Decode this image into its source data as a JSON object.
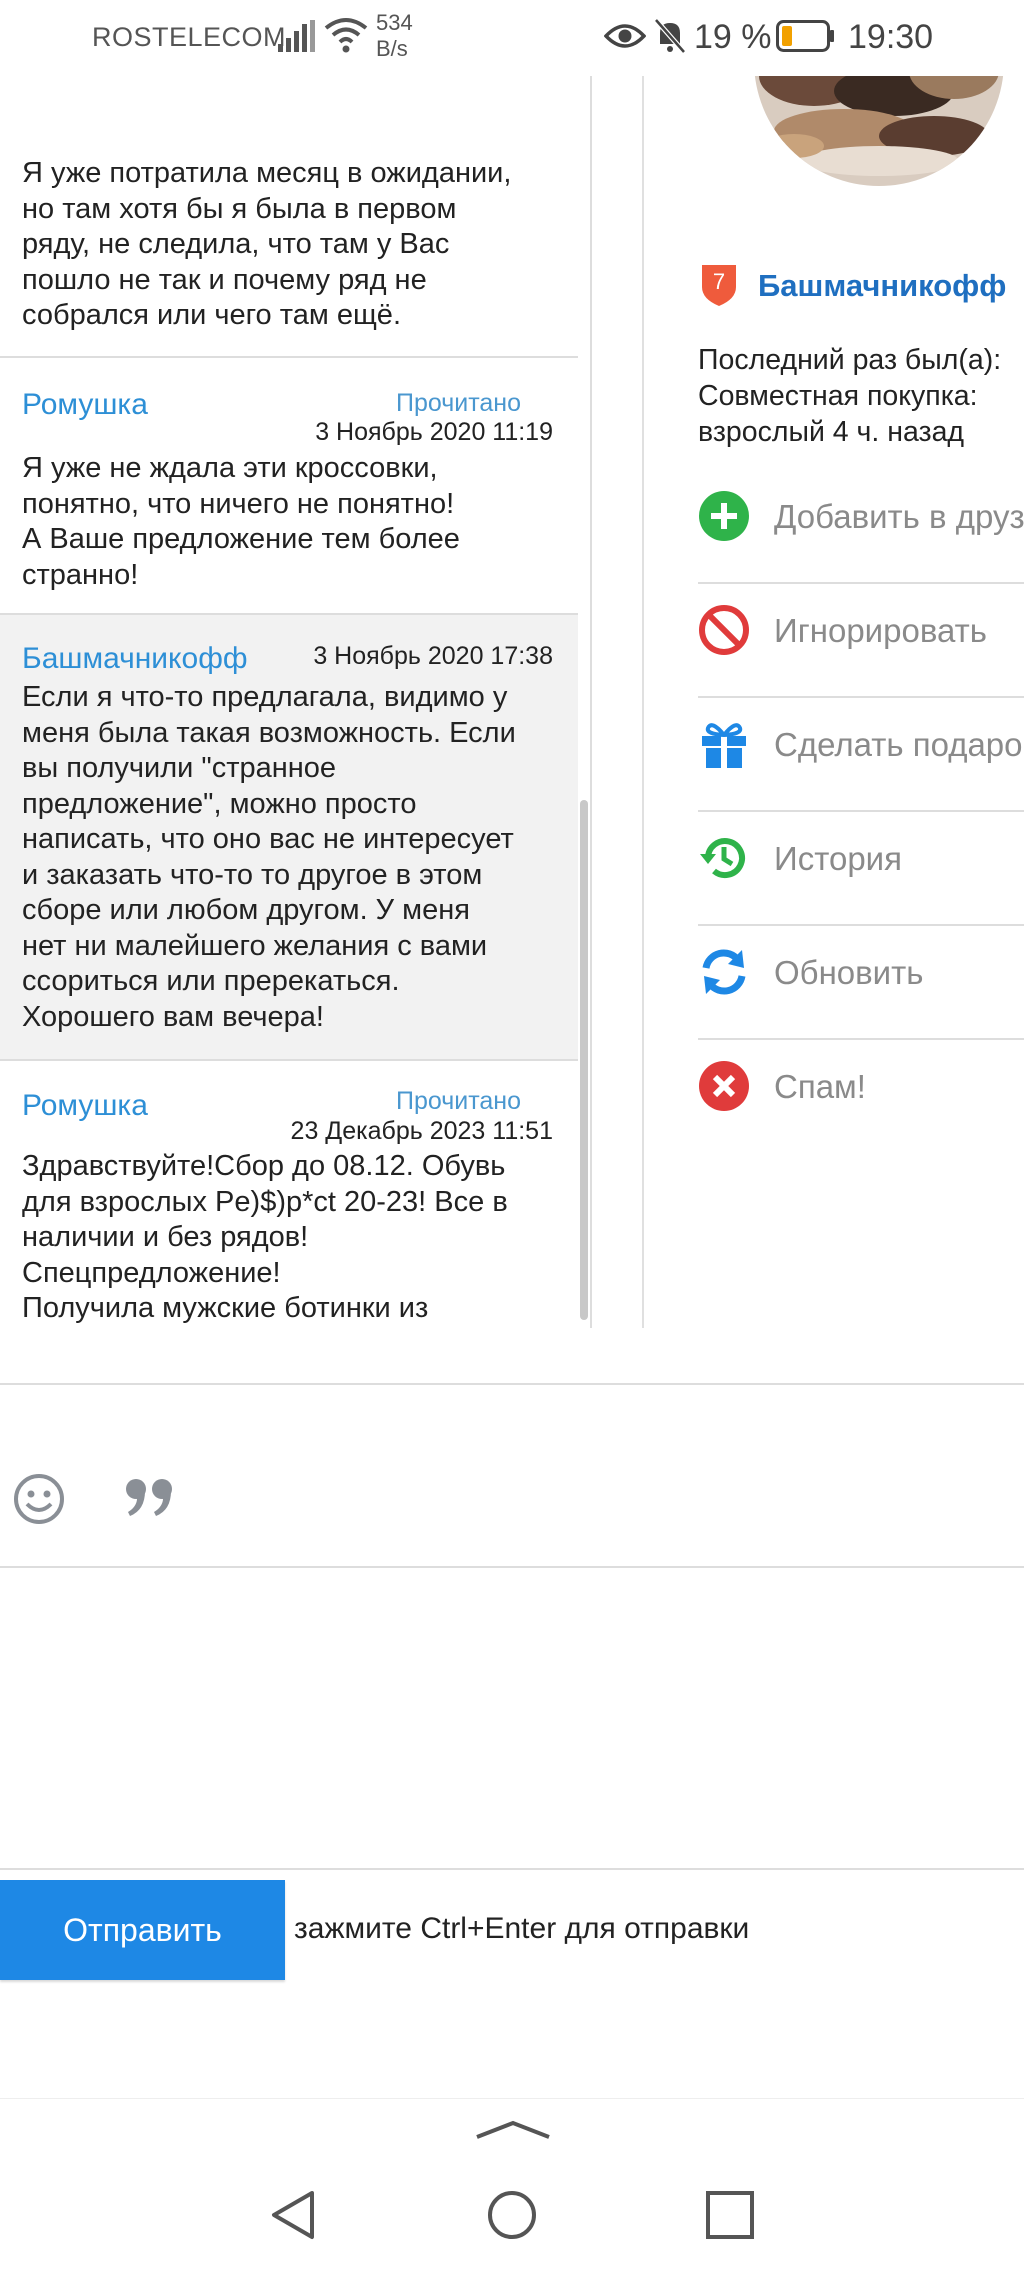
{
  "status_bar": {
    "carrier": "ROSTELECOM",
    "speed_value": "534",
    "speed_unit": "B/s",
    "battery_percent": "19 %",
    "time": "19:30"
  },
  "messages": [
    {
      "author": "",
      "status": "",
      "date": "",
      "body": "Я уже потратила месяц в ожидании,\nно там хотя бы я была в первом\nряду, не следила, что там у Вас\nпошло не так и почему ряд не\nсобрался или чего там ещё."
    },
    {
      "author": "Ромушка",
      "status": "Прочитано",
      "date": "3 Ноябрь 2020 11:19",
      "body": "Я уже не ждала эти кроссовки,\nпонятно, что ничего не понятно!\nА Ваше предложение тем более\nстранно!"
    },
    {
      "author": "Башмачникофф",
      "status": "",
      "date": "3 Ноябрь 2020 17:38",
      "body": "Если я что-то предлагала, видимо у\nменя была такая возможность. Если\nвы получили \"странное\nпредложение\", можно просто\nнаписать, что оно вас не интересует\nи заказать что-то то другое в этом\nсборе или любом другом. У меня\nнет ни малейшего желания с вами\nссориться или пререкаться.\nХорошего вам вечера!"
    },
    {
      "author": "Ромушка",
      "status": "Прочитано",
      "date": "23 Декабрь 2023 11:51",
      "body": "Здравствуйте!Сбор до 08.12. Обувь\nдля взрослых Pe)$)p*ct 20-23! Все в\nналичии и без рядов!\nСпецпредложение!\nПолучила мужские ботинки из\nпристроя, они совершенно другие,\nчто делать?"
    }
  ],
  "profile": {
    "rank": "7",
    "username": "Башмачникофф",
    "last_seen": "Последний раз был(а):\nСовместная покупка:\nвзрослый 4 ч. назад",
    "actions": [
      {
        "label": "Добавить в друзья",
        "icon": "add-friend-icon",
        "color": "#2fb34a"
      },
      {
        "label": "Игнорировать",
        "icon": "block-icon",
        "color": "#e03b3b"
      },
      {
        "label": "Сделать подарок",
        "icon": "gift-icon",
        "color": "#1e88e5"
      },
      {
        "label": "История",
        "icon": "history-icon",
        "color": "#2fb34a"
      },
      {
        "label": "Обновить",
        "icon": "refresh-icon",
        "color": "#1e88e5"
      },
      {
        "label": "Спам!",
        "icon": "spam-icon",
        "color": "#e03b3b"
      }
    ]
  },
  "compose": {
    "emoji_icon": "emoji-icon",
    "quote_icon": "quote-icon",
    "text_value": "",
    "send_label": "Отправить",
    "hint": "зажмите Ctrl+Enter для отправки"
  },
  "colors": {
    "accent": "#1e88e5",
    "link": "#2d8fd6",
    "username": "#1f6fc0",
    "divider": "#dddddd"
  }
}
